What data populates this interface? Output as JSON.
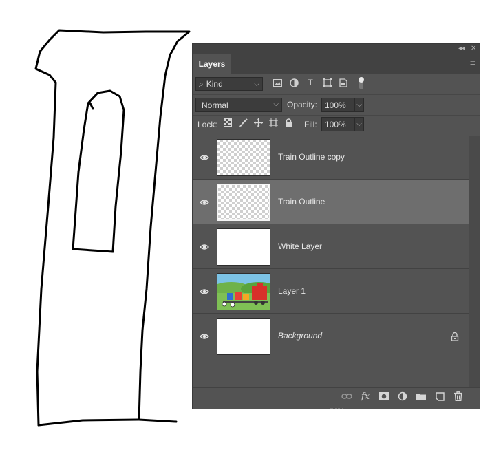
{
  "panel": {
    "tab_label": "Layers",
    "collapse_glyph": "◂◂",
    "close_glyph": "✕",
    "menu_glyph": "≡"
  },
  "filter": {
    "search_glyph": "⌕",
    "kind_label": "Kind",
    "icons": [
      "image-filter-icon",
      "adjustment-filter-icon",
      "type-filter-icon",
      "shape-filter-icon",
      "smart-object-filter-icon"
    ]
  },
  "blend": {
    "mode": "Normal",
    "opacity_label": "Opacity:",
    "opacity_value": "100%"
  },
  "lock": {
    "label": "Lock:",
    "fill_label": "Fill:",
    "fill_value": "100%"
  },
  "layers": [
    {
      "name": "Train Outline copy",
      "thumbnail": "transparent",
      "selected": false,
      "locked": false,
      "italic": false
    },
    {
      "name": "Train Outline",
      "thumbnail": "transparent",
      "selected": true,
      "locked": false,
      "italic": false
    },
    {
      "name": "White Layer",
      "thumbnail": "white",
      "selected": false,
      "locked": false,
      "italic": false
    },
    {
      "name": "Layer 1",
      "thumbnail": "train-illustration",
      "selected": false,
      "locked": false,
      "italic": false
    },
    {
      "name": "Background",
      "thumbnail": "white",
      "selected": false,
      "locked": true,
      "italic": true
    }
  ],
  "bottom_icons": [
    "link-layers-icon",
    "fx-icon",
    "layer-mask-icon",
    "adjustment-layer-icon",
    "new-group-icon",
    "new-layer-icon",
    "delete-layer-icon"
  ],
  "colors": {
    "panel_bg": "#535353",
    "selected_row": "#6e6e6e",
    "header_bg": "#424242"
  }
}
